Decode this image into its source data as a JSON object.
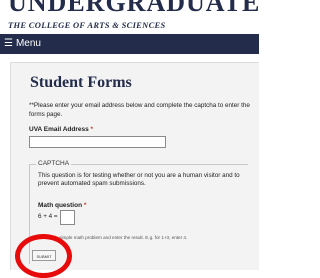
{
  "header": {
    "site_name": "UNDERGRADUATE",
    "site_subtitle": "THE COLLEGE OF ARTS & SCIENCES"
  },
  "menu": {
    "icon": "hamburger-icon",
    "label": "Menu"
  },
  "form": {
    "title": "Student Forms",
    "instructions": "**Please enter your email address below and complete the captcha to enter the forms page.",
    "required_marker": "*",
    "email_label": "UVA Email Address",
    "email_value": "",
    "captcha": {
      "legend": "CAPTCHA",
      "description": "This question is for testing whether or not you are a human visitor and to prevent automated spam submissions.",
      "math_label": "Math question",
      "math_problem": "6 + 4 =",
      "math_value": "",
      "help_text": "Solve this simple math problem and enter the result. E.g. for 1+3, enter 4."
    },
    "submit_label": "SUBMIT"
  },
  "annotation": {
    "color": "#e80b0b"
  },
  "colors": {
    "brand": "#232d4b",
    "required": "#c0392b"
  }
}
